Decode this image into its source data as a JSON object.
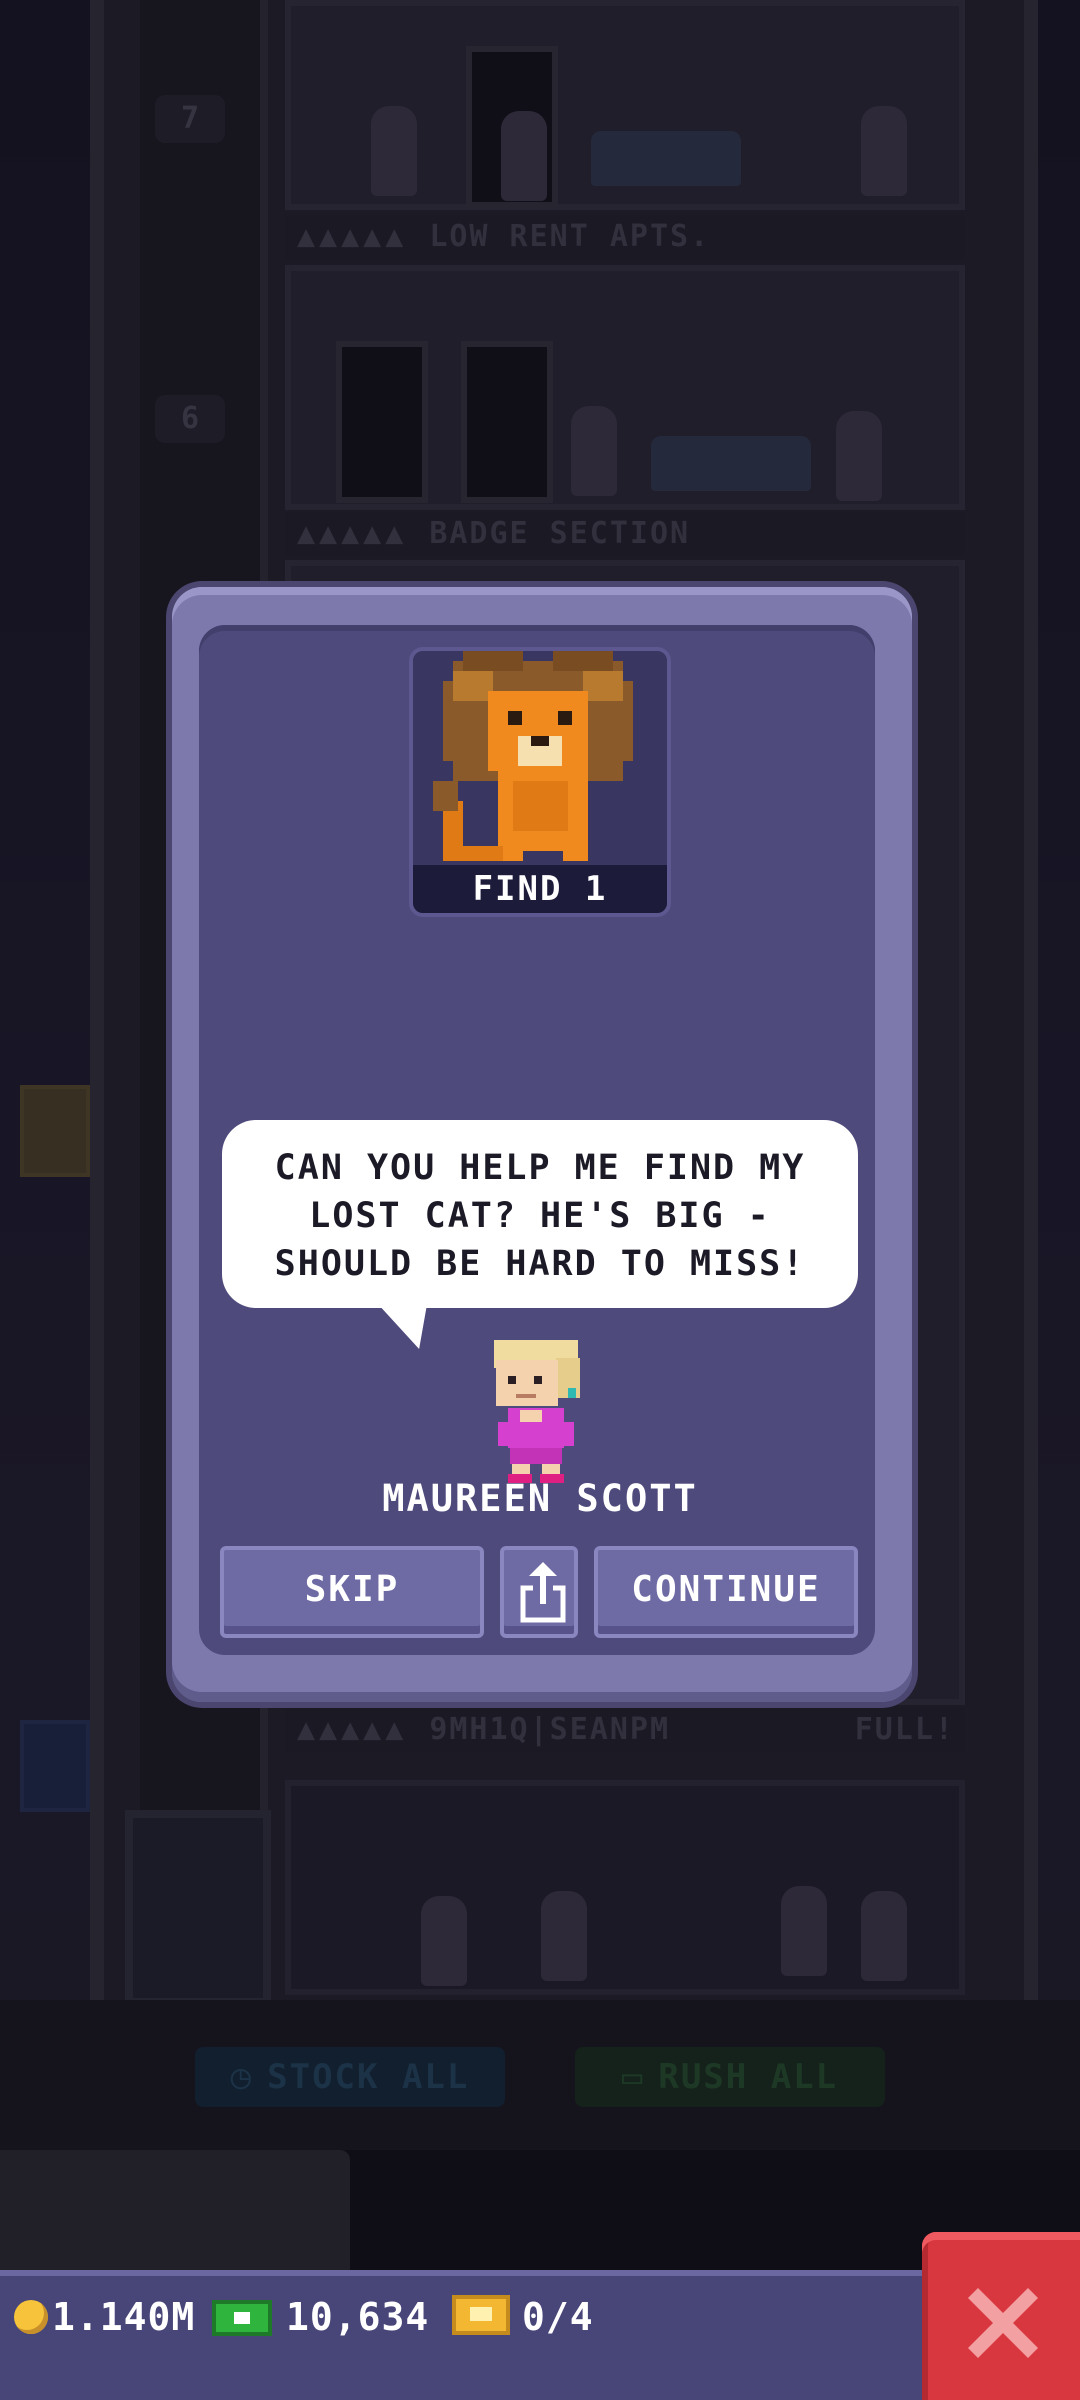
{
  "tower": {
    "floor_numbers": [
      "7",
      "6"
    ],
    "floors": [
      {
        "name": "LOW RENT APTS.",
        "stars": "▲▲▲▲▲",
        "status": ""
      },
      {
        "name": "BADGE SECTION",
        "stars": "▲▲▲▲▲",
        "status": ""
      },
      {
        "name": "9MH1Q|SEANPM",
        "stars": "▲▲▲▲▲",
        "status": "FULL!"
      }
    ]
  },
  "actions": {
    "stock_all": "STOCK ALL",
    "rush_all": "RUSH ALL"
  },
  "dialog": {
    "badge_label": "FIND 1",
    "badge_icon": "lion-icon",
    "message_lines": [
      "CAN YOU HELP ME FIND MY",
      "LOST CAT? HE'S BIG -",
      "SHOULD BE HARD TO MISS!"
    ],
    "npc_name": "MAUREEN SCOTT",
    "skip_label": "SKIP",
    "continue_label": "CONTINUE"
  },
  "status": {
    "coins": "1.140M",
    "bux": "10,634",
    "tickets": "0/4"
  },
  "colors": {
    "modal_outer": "#7d79ad",
    "modal_inner": "#4e4a7c",
    "button": "#6e6aa4",
    "status_bar": "#484579",
    "close": "#d9373f",
    "coin": "#f6c33a",
    "bux": "#2fb43e",
    "ticket": "#f3b731"
  }
}
